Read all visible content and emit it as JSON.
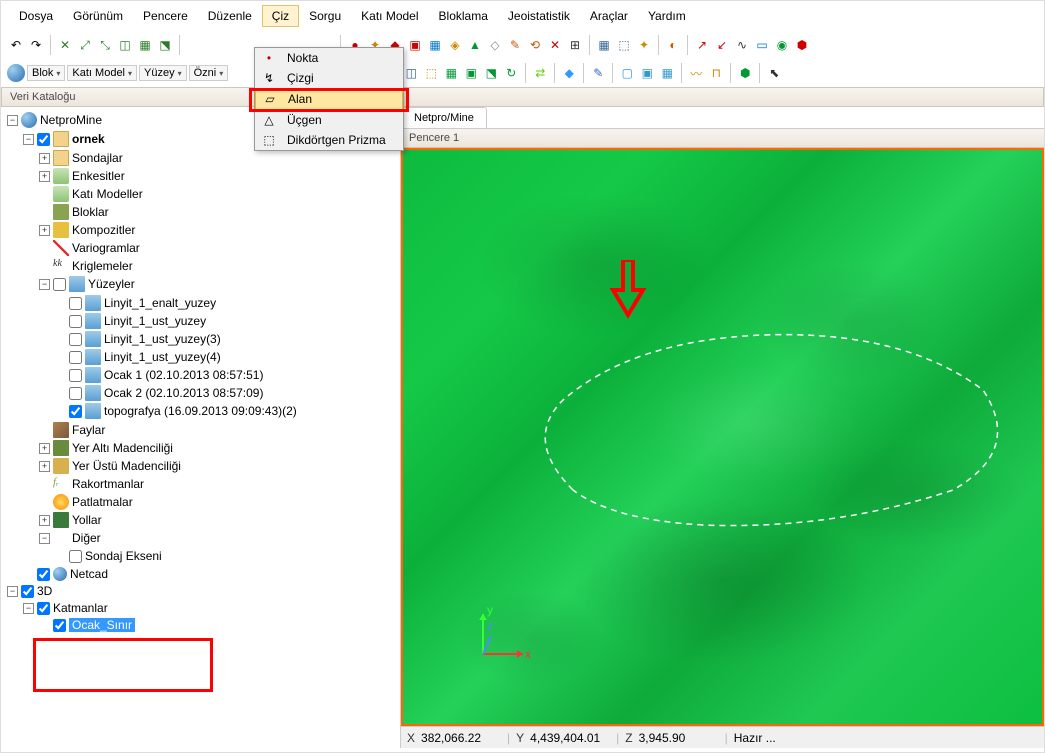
{
  "menubar": {
    "items": [
      "Dosya",
      "Görünüm",
      "Pencere",
      "Düzenle",
      "Çiz",
      "Sorgu",
      "Katı Model",
      "Bloklama",
      "Jeoistatistik",
      "Araçlar",
      "Yardım"
    ],
    "active_index": 4
  },
  "dropdown": {
    "items": [
      {
        "icon": "•",
        "label": "Nokta"
      },
      {
        "icon": "↯",
        "label": "Çizgi"
      },
      {
        "icon": "▱",
        "label": "Alan",
        "highlighted": true
      },
      {
        "icon": "△",
        "label": "Üçgen"
      },
      {
        "icon": "⬚",
        "label": "Dikdörtgen Prizma"
      }
    ]
  },
  "toolbar2": {
    "labels": {
      "blok": "Blok",
      "kati": "Katı Model",
      "yuzey": "Yüzey",
      "oznitelik": "Özni"
    }
  },
  "sidebar": {
    "title": "Veri Kataloğu"
  },
  "tree": {
    "root": "NetproMine",
    "ornek": "ornek",
    "children": {
      "sondajlar": "Sondajlar",
      "enkesitler": "Enkesitler",
      "kati": "Katı Modeller",
      "bloklar": "Bloklar",
      "kompozitler": "Kompozitler",
      "variogramlar": "Variogramlar",
      "kriglemeler": "Kriglemeler",
      "yuzeyler": "Yüzeyler",
      "surf1": "Linyit_1_enalt_yuzey",
      "surf2": "Linyit_1_ust_yuzey",
      "surf3": "Linyit_1_ust_yuzey(3)",
      "surf4": "Linyit_1_ust_yuzey(4)",
      "surf5": "Ocak 1 (02.10.2013 08:57:51)",
      "surf6": "Ocak 2 (02.10.2013 08:57:09)",
      "surf7": "topografya (16.09.2013 09:09:43)(2)",
      "faylar": "Faylar",
      "yeralti": "Yer Altı Madenciliği",
      "yerustu": "Yer Üstü Madenciliği",
      "rakortmanlar": "Rakortmanlar",
      "patlatmalar": "Patlatmalar",
      "yollar": "Yollar",
      "diger": "Diğer",
      "sondaj_ekseni": "Sondaj Ekseni"
    },
    "netcad": "Netcad",
    "three_d": "3D",
    "katmanlar": "Katmanlar",
    "ocak_sinir": "Ocak_Sınır"
  },
  "tabs": {
    "main": "Netpro/Mine"
  },
  "subheader": {
    "label": "Pencere 1"
  },
  "gizmo": {
    "x": "x",
    "y": "y",
    "z": "z"
  },
  "statusbar": {
    "x_label": "X",
    "x": "382,066.22",
    "y_label": "Y",
    "y": "4,439,404.01",
    "z_label": "Z",
    "z": "3,945.90",
    "status": "Hazır ..."
  }
}
